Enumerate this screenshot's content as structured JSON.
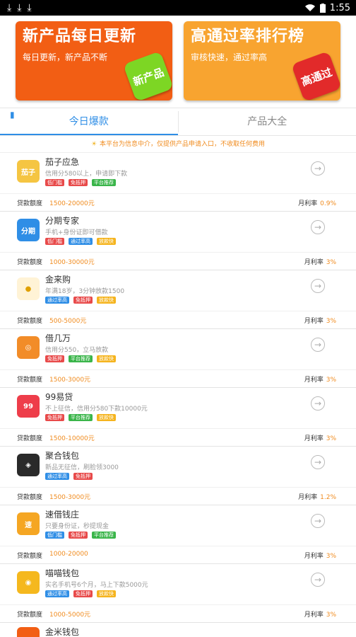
{
  "status": {
    "time": "1:55",
    "download_icons": [
      "⤓",
      "⤓",
      "⤓"
    ]
  },
  "banners": [
    {
      "title": "新产品每日更新",
      "subtitle": "每日更新，新产品不断",
      "badge": "新产品",
      "color": "#f25e14",
      "badge_color": "#7dd624"
    },
    {
      "title": "高通过率排行榜",
      "subtitle": "审核快速，通过率高",
      "badge": "高通过",
      "color": "#f8a430",
      "badge_color": "#e22a2a"
    }
  ],
  "tabs": [
    {
      "label": "今日爆款",
      "active": true
    },
    {
      "label": "产品大全",
      "active": false
    }
  ],
  "notice": "本平台为信息中介，仅提供产品申请入口，不收取任何费用",
  "labels": {
    "amount": "贷款额度",
    "rate": "月利率"
  },
  "items": [
    {
      "name": "茄子应急",
      "desc": "信用分580以上，申请即下款",
      "amount": "1500-20000元",
      "rate": "0.9%",
      "icon_text": "茄子",
      "icon_color": "#f5c542",
      "tags": [
        {
          "t": "低门槛",
          "c": "#e84a4a"
        },
        {
          "t": "免抵押",
          "c": "#e84a4a"
        },
        {
          "t": "平台推荐",
          "c": "#3ab54a"
        }
      ]
    },
    {
      "name": "分期专家",
      "desc": "手机+身份证即可借款",
      "amount": "1000-30000元",
      "rate": "3%",
      "icon_text": "分期",
      "icon_color": "#2f8ee6",
      "tags": [
        {
          "t": "低门槛",
          "c": "#e84a4a"
        },
        {
          "t": "通过率高",
          "c": "#2f8ee6"
        },
        {
          "t": "放款快",
          "c": "#f5b41e"
        }
      ]
    },
    {
      "name": "金来购",
      "desc": "年满18岁，3分钟放款1500",
      "amount": "500-5000元",
      "rate": "3%",
      "icon_text": "●",
      "icon_color": "#fff3d6",
      "tags": [
        {
          "t": "通过率高",
          "c": "#2f8ee6"
        },
        {
          "t": "免抵押",
          "c": "#e84a4a"
        },
        {
          "t": "放款快",
          "c": "#f5b41e"
        }
      ]
    },
    {
      "name": "借几万",
      "desc": "信用分550，立马放款",
      "amount": "1500-3000元",
      "rate": "3%",
      "icon_text": "◎",
      "icon_color": "#f28c28",
      "tags": [
        {
          "t": "免抵押",
          "c": "#e84a4a"
        },
        {
          "t": "平台推荐",
          "c": "#3ab54a"
        },
        {
          "t": "放款快",
          "c": "#f5b41e"
        }
      ]
    },
    {
      "name": "99易贷",
      "desc": "不上征信，信用分580下款10000元",
      "amount": "1500-10000元",
      "rate": "3%",
      "icon_text": "99",
      "icon_color": "#ee3d4a",
      "tags": [
        {
          "t": "免抵押",
          "c": "#e84a4a"
        },
        {
          "t": "平台推荐",
          "c": "#3ab54a"
        },
        {
          "t": "放款快",
          "c": "#f5b41e"
        }
      ]
    },
    {
      "name": "聚合钱包",
      "desc": "新品无征信，刷脸领3000",
      "amount": "1500-3000元",
      "rate": "1.2%",
      "icon_text": "◈",
      "icon_color": "#2a2a2a",
      "tags": [
        {
          "t": "通过率高",
          "c": "#2f8ee6"
        },
        {
          "t": "免抵押",
          "c": "#e84a4a"
        }
      ]
    },
    {
      "name": "速借钱庄",
      "desc": "只要身份证，秒提现金",
      "amount": "1000-20000",
      "rate": "3%",
      "icon_text": "速",
      "icon_color": "#f5a623",
      "tags": [
        {
          "t": "低门槛",
          "c": "#2f8ee6"
        },
        {
          "t": "免抵押",
          "c": "#e84a4a"
        },
        {
          "t": "平台推荐",
          "c": "#3ab54a"
        }
      ]
    },
    {
      "name": "喵喵钱包",
      "desc": "实名手机号6个月，马上下款5000元",
      "amount": "1000-5000元",
      "rate": "3%",
      "icon_text": "◉",
      "icon_color": "#f5b81e",
      "tags": [
        {
          "t": "通过率高",
          "c": "#2f8ee6"
        },
        {
          "t": "免抵押",
          "c": "#e84a4a"
        },
        {
          "t": "放款快",
          "c": "#f5b41e"
        }
      ]
    }
  ],
  "partial_item": {
    "name": "金米钱包",
    "icon_color": "#f25e14"
  }
}
